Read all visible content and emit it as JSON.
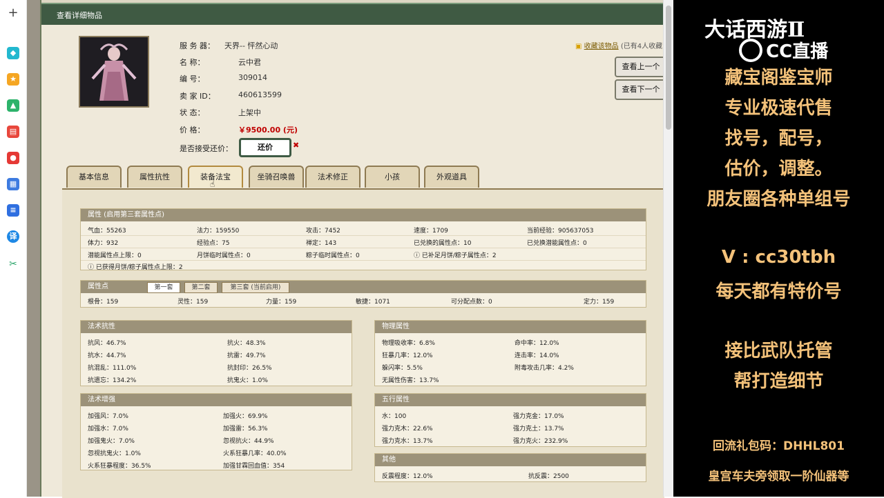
{
  "sidebar": {
    "icons": [
      "plus-icon",
      "shape-icon",
      "star-icon",
      "image-ai-icon",
      "pdf-ai-icon",
      "camera-ai-icon",
      "chart-ai-icon",
      "doc-ai-icon",
      "translate-icon",
      "scissors-icon"
    ],
    "translate_label": "译"
  },
  "window_title": "查看详细物品",
  "item": {
    "server_label": "服 务 器：",
    "server_value": "天界-- 怦然心动",
    "name_label": "名          称：",
    "name_value": "云中君",
    "id_label": "编          号：",
    "id_value": "309014",
    "seller_label": "卖   家   ID：",
    "seller_value": "460613599",
    "status_label": "状          态：",
    "status_value": "上架中",
    "price_label": "价          格：",
    "price_value": "￥9500.00 (元)",
    "counter_label": "是否接受还价：",
    "counter_button": "还价",
    "counter_mark": "✖"
  },
  "favorite": {
    "link": "收藏该物品",
    "count_text": "(已有4人收藏"
  },
  "nav": {
    "prev": "查看上一个",
    "next": "查看下一个"
  },
  "tabs": [
    "基本信息",
    "属性抗性",
    "装备法宝",
    "坐骑召唤兽",
    "法术修正",
    "小孩",
    "外观道具"
  ],
  "attrs": {
    "header": "属性 (启用第三套属性点)",
    "rows": [
      [
        "气血：55263",
        "法力：159550",
        "攻击：7452",
        "速度：1709",
        "当前经验：905637053"
      ],
      [
        "体力：932",
        "经验点：75",
        "禅定：143",
        "已兑换的属性点：10",
        "已兑换潜能属性点：0"
      ],
      [
        "潜能属性点上限：0",
        "月饼临时属性点：0",
        "粽子临时属性点：0",
        "ⓘ 已补足月饼/粽子属性点：2",
        ""
      ],
      [
        "ⓘ 已获得月饼/粽子属性点上限：2",
        "",
        "",
        "",
        ""
      ]
    ]
  },
  "points": {
    "header": "属性点",
    "tabs": [
      "第一套",
      "第二套",
      "第三套 (当前启用)"
    ],
    "values": [
      "根骨：159",
      "灵性：159",
      "力量：159",
      "敏捷：1071",
      "可分配点数：0",
      "定力：159"
    ]
  },
  "resist": {
    "header": "法术抗性",
    "rows": [
      [
        "抗风：46.7%",
        "抗火：48.3%"
      ],
      [
        "抗水：44.7%",
        "抗雷：49.7%"
      ],
      [
        "抗混乱：111.0%",
        "抗封印：26.5%"
      ],
      [
        "抗遗忘：134.2%",
        "抗鬼火：1.0%"
      ]
    ]
  },
  "physical": {
    "header": "物理属性",
    "rows": [
      [
        "物理吸收率：6.8%",
        "命中率：12.0%"
      ],
      [
        "狂暴几率：12.0%",
        "连击率：14.0%"
      ],
      [
        "躲闪率：5.5%",
        "附毒攻击几率：4.2%"
      ],
      [
        "无属性伤害：13.7%",
        ""
      ]
    ]
  },
  "enhance": {
    "header": "法术增强",
    "rows": [
      [
        "加强风：7.0%",
        "加强火：69.9%"
      ],
      [
        "加强水：7.0%",
        "加强雷：56.3%"
      ],
      [
        "加强鬼火：7.0%",
        "忽视抗火：44.9%"
      ],
      [
        "忽视抗鬼火：1.0%",
        "火系狂暴几率：40.0%"
      ],
      [
        "火系狂暴程度：36.5%",
        "加强甘霖回血值：354"
      ]
    ]
  },
  "elements": {
    "header": "五行属性",
    "rows": [
      [
        "水：100",
        "强力克金：17.0%"
      ],
      [
        "强力克木：22.6%",
        "强力克土：13.7%"
      ],
      [
        "强力克水：13.7%",
        "强力克火：232.9%"
      ]
    ]
  },
  "other": {
    "header": "其他",
    "rows": [
      [
        "反震程度：12.0%",
        "抗反震：2500"
      ]
    ]
  },
  "stream": {
    "game_logo": "大话西游Ⅱ",
    "cc_logo": "CC直播",
    "lines": [
      "藏宝阁鉴宝师",
      "专业极速代售",
      "找号，配号，",
      "估价，调整。",
      "朋友圈各种单组号"
    ],
    "wechat": "V  :  cc30tbh",
    "daily": "每天都有特价号",
    "lines2": [
      "接比武队托管",
      "帮打造细节"
    ],
    "gift_code": "回流礼包码：DHHL801",
    "gift_note": "皇宫车夫旁领取一阶仙器等"
  },
  "colors": {
    "panel_title": "#3f5a43",
    "promo_text": "#f4c27a",
    "price": "#c00000"
  }
}
